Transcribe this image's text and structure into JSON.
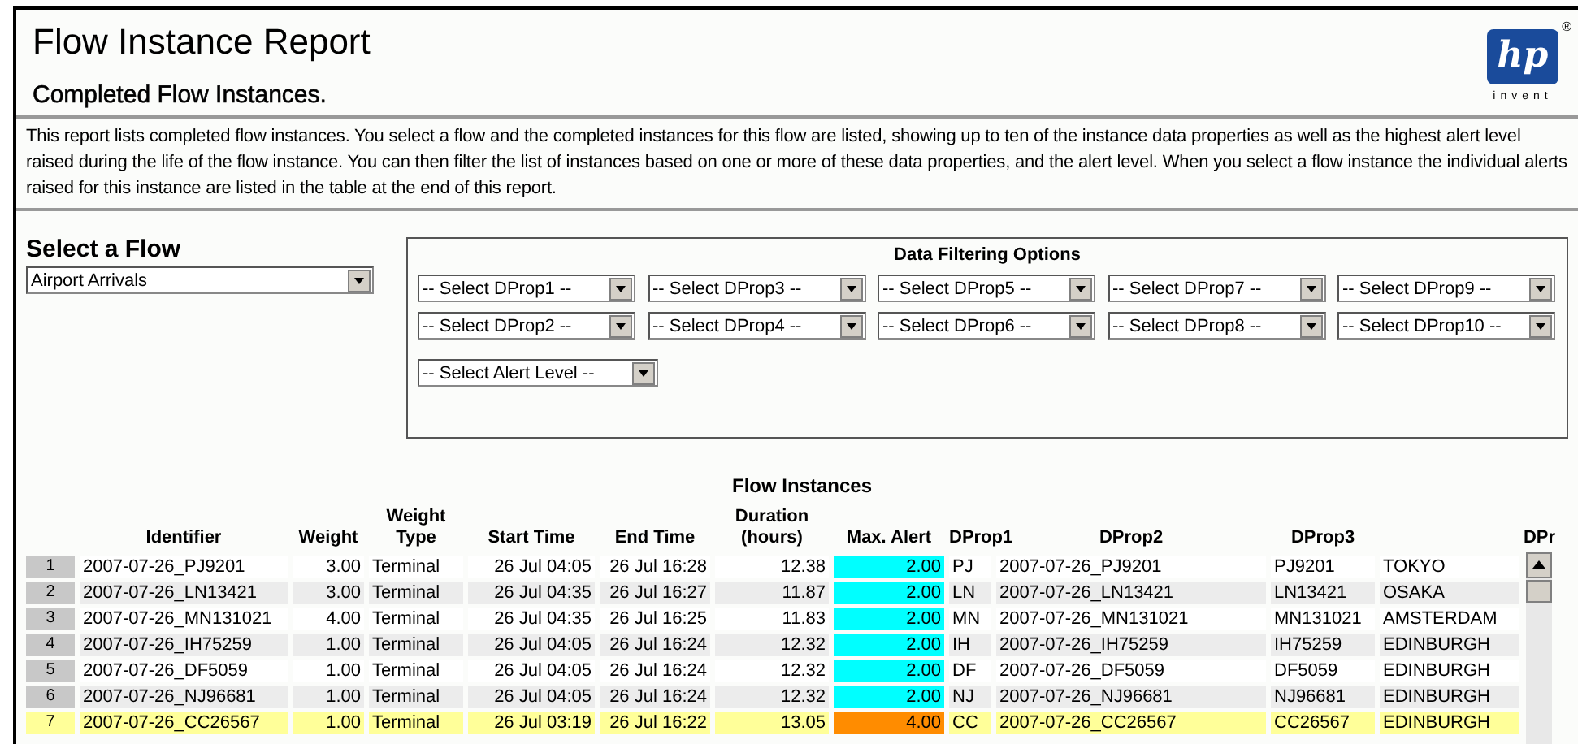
{
  "header": {
    "title": "Flow Instance Report",
    "subtitle": "Completed Flow Instances.",
    "logo": {
      "mark": "hp",
      "tagline": "invent",
      "registered": "®"
    }
  },
  "description": "This report lists completed flow instances. You select a flow and the completed instances for this flow are listed, showing up to ten of the instance data properties as well as the highest alert level raised during the life of the flow instance. You can then filter the list of instances based on one or more of these data properties, and the alert level. When you select a flow instance the individual alerts raised for this instance are listed in the table at the end of this report.",
  "flow_select": {
    "label": "Select a Flow",
    "value": "Airport Arrivals"
  },
  "filters": {
    "title": "Data Filtering Options",
    "rows": [
      [
        "-- Select DProp1 --",
        "-- Select DProp3 --",
        "-- Select DProp5 --",
        "-- Select DProp7 --",
        "-- Select DProp9 --"
      ],
      [
        "-- Select DProp2 --",
        "-- Select DProp4 --",
        "-- Select DProp6 --",
        "-- Select DProp8 --",
        "-- Select DProp10 --"
      ],
      [
        "-- Select Alert Level --"
      ]
    ]
  },
  "table": {
    "title": "Flow Instances",
    "columns": [
      "Identifier",
      "Weight",
      "Weight Type",
      "Start Time",
      "End Time",
      "Duration (hours)",
      "Max. Alert",
      "DProp1",
      "DProp2",
      "DProp3",
      "DPr"
    ],
    "rows": [
      {
        "index": "1",
        "cells": [
          "2007-07-26_PJ9201",
          "3.00",
          "Terminal",
          "26 Jul 04:05",
          "26 Jul 16:28",
          "12.38",
          "2.00",
          "PJ",
          "2007-07-26_PJ9201",
          "PJ9201",
          "TOKYO"
        ],
        "color": "#00ffff",
        "selected": false
      },
      {
        "index": "2",
        "cells": [
          "2007-07-26_LN13421",
          "3.00",
          "Terminal",
          "26 Jul 04:35",
          "26 Jul 16:27",
          "11.87",
          "2.00",
          "LN",
          "2007-07-26_LN13421",
          "LN13421",
          "OSAKA"
        ],
        "color": "#00ffff",
        "selected": false
      },
      {
        "index": "3",
        "cells": [
          "2007-07-26_MN131021",
          "4.00",
          "Terminal",
          "26 Jul 04:35",
          "26 Jul 16:25",
          "11.83",
          "2.00",
          "MN",
          "2007-07-26_MN131021",
          "MN131021",
          "AMSTERDAM"
        ],
        "color": "#00ffff",
        "selected": false
      },
      {
        "index": "4",
        "cells": [
          "2007-07-26_IH75259",
          "1.00",
          "Terminal",
          "26 Jul 04:05",
          "26 Jul 16:24",
          "12.32",
          "2.00",
          "IH",
          "2007-07-26_IH75259",
          "IH75259",
          "EDINBURGH"
        ],
        "color": "#00ffff",
        "selected": false
      },
      {
        "index": "5",
        "cells": [
          "2007-07-26_DF5059",
          "1.00",
          "Terminal",
          "26 Jul 04:05",
          "26 Jul 16:24",
          "12.32",
          "2.00",
          "DF",
          "2007-07-26_DF5059",
          "DF5059",
          "EDINBURGH"
        ],
        "color": "#00ffff",
        "selected": false
      },
      {
        "index": "6",
        "cells": [
          "2007-07-26_NJ96681",
          "1.00",
          "Terminal",
          "26 Jul 04:05",
          "26 Jul 16:24",
          "12.32",
          "2.00",
          "NJ",
          "2007-07-26_NJ96681",
          "NJ96681",
          "EDINBURGH"
        ],
        "color": "#00ffff",
        "selected": false
      },
      {
        "index": "7",
        "cells": [
          "2007-07-26_CC26567",
          "1.00",
          "Terminal",
          "26 Jul 03:19",
          "26 Jul 16:22",
          "13.05",
          "4.00",
          "CC",
          "2007-07-26_CC26567",
          "CC26567",
          "EDINBURGH"
        ],
        "color": "#ff8c00",
        "selected": true
      }
    ]
  }
}
